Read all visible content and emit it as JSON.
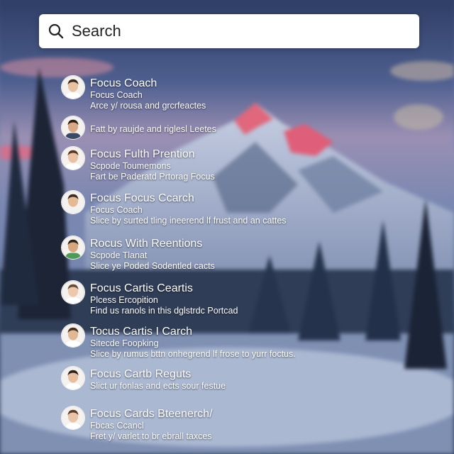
{
  "search": {
    "placeholder": "Search"
  },
  "results": [
    {
      "title": "Focus Coach",
      "line1": "Focus Coach",
      "line2": "Arce y/ rousa and grcrfeactes",
      "avatar": {
        "skin": "#e8c2a0",
        "hair": "#3a2a1e",
        "shirt": "#ffffff"
      }
    },
    {
      "title": "",
      "line1": "Fatt by raujde and riglesl Leetes",
      "line2": "",
      "avatar": {
        "skin": "#d9a886",
        "hair": "#2a1d14",
        "shirt": "#3a4a66"
      }
    },
    {
      "title": "Focus Fulth Prention",
      "line1": "Scpode Toumemons",
      "line2": "Fart be Paderatd Prtorag Focus",
      "avatar": {
        "skin": "#e9c1a4",
        "hair": "#5a3520",
        "shirt": "#ffffff"
      }
    },
    {
      "title": "Focus Focus Ccarch",
      "line1": "Focus Coach",
      "line2": "Slice by surted tling ineerend lf frust and an cattes",
      "avatar": {
        "skin": "#e4b995",
        "hair": "#3b2b20",
        "shirt": "#f2f2f2"
      }
    },
    {
      "title": "Rocus With Reentions",
      "line1": "Scpode Tlanat",
      "line2": "Slice ye Poded Sodentled cacts",
      "avatar": {
        "skin": "#d6a67e",
        "hair": "#2e2118",
        "shirt": "#4f9a59"
      }
    },
    {
      "title": "Focus Cartis Ceartis",
      "line1": "Plcess Ercopition",
      "line2": "Find us ranols in this dglstrdc Portcad",
      "avatar": {
        "skin": "#eec8ac",
        "hair": "#6b4a33",
        "shirt": "#ffffff"
      }
    },
    {
      "title": "Tocus Cartis I Carch",
      "line1": "Sitecde Foopking",
      "line2": "Slice by rumus bttn onhegrend lf frose to yurr foctus.",
      "avatar": {
        "skin": "#e1b896",
        "hair": "#4a2f1c",
        "shirt": "#ffffff"
      }
    },
    {
      "title": "Focus Cartb Reguts",
      "line1": "Slict ur fonlas and ects sour festue",
      "line2": "",
      "avatar": {
        "skin": "#e6bf9f",
        "hair": "#2b1f17",
        "shirt": "#ffffff"
      }
    },
    {
      "title": "Focus Cards Bteenerch/",
      "line1": "Fbcas Ccancl",
      "line2": "Fret y/ varlet to br ebrall taxces",
      "avatar": {
        "skin": "#e9c4a8",
        "hair": "#5c3b25",
        "shirt": "#ffffff"
      }
    }
  ]
}
